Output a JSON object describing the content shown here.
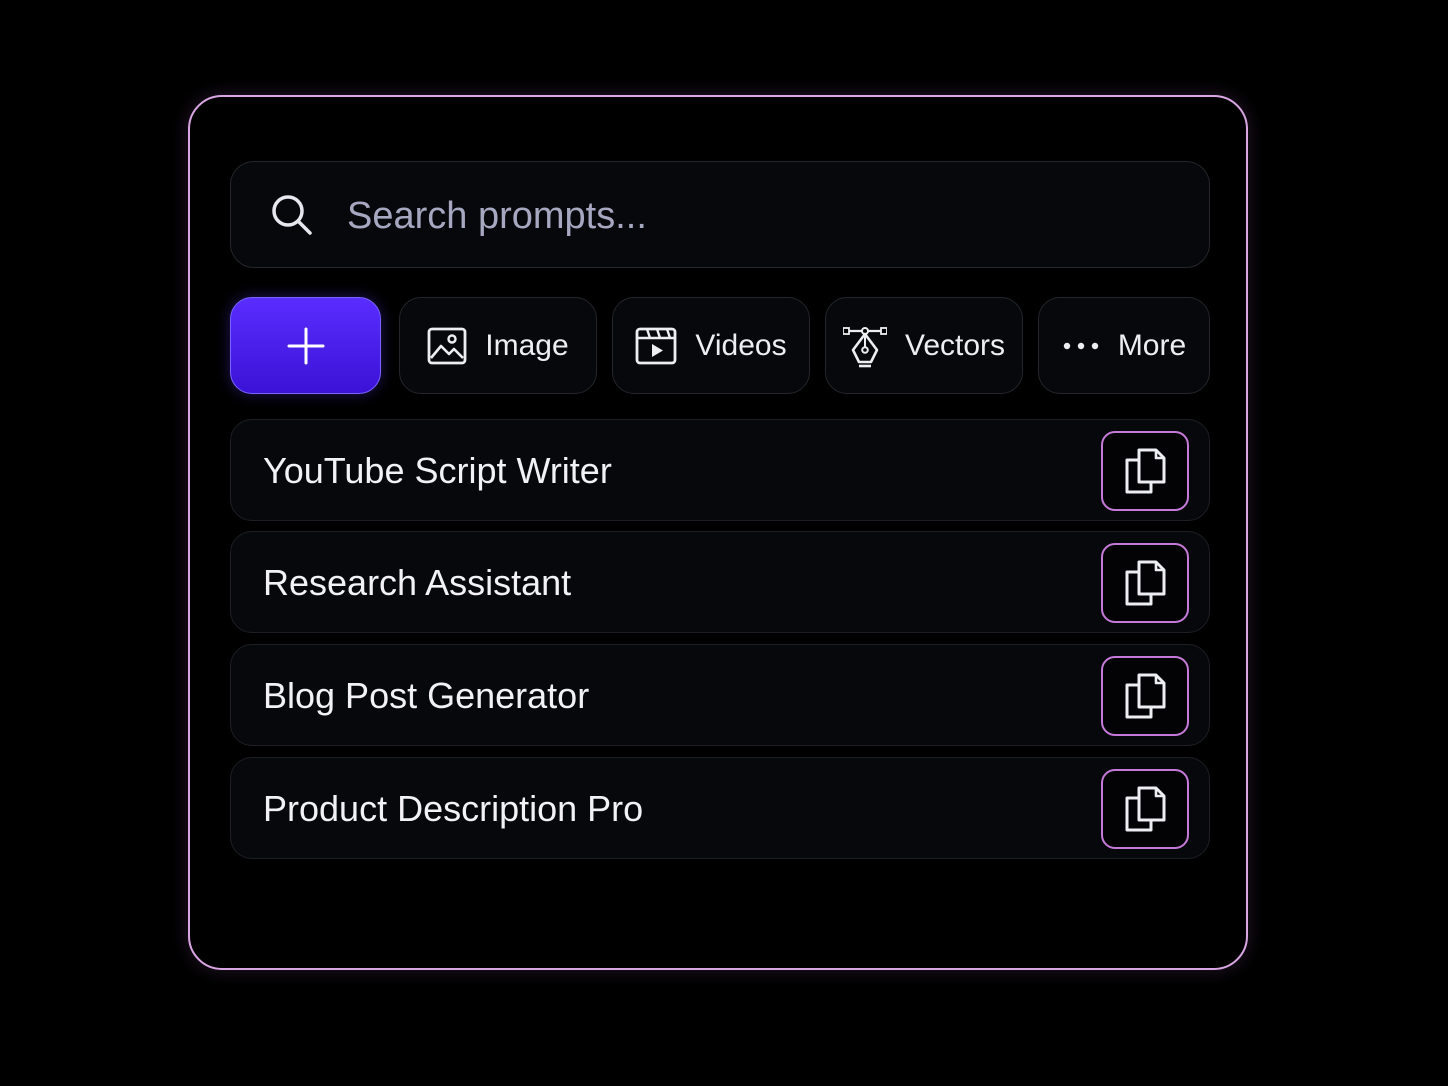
{
  "search": {
    "placeholder": "Search prompts...",
    "value": ""
  },
  "chips": {
    "add_icon": "plus-icon",
    "image": {
      "label": "Image",
      "icon": "image-icon"
    },
    "videos": {
      "label": "Videos",
      "icon": "video-clapper-icon"
    },
    "vectors": {
      "label": "Vectors",
      "icon": "pen-tool-icon"
    },
    "more": {
      "label": "More",
      "icon": "more-dots-icon"
    }
  },
  "prompts": [
    {
      "title": "YouTube Script Writer",
      "action_icon": "copy-icon"
    },
    {
      "title": "Research Assistant",
      "action_icon": "copy-icon"
    },
    {
      "title": "Blog Post Generator",
      "action_icon": "copy-icon"
    },
    {
      "title": "Product Description Pro",
      "action_icon": "copy-icon"
    }
  ],
  "colors": {
    "background": "#000000",
    "panel_border": "#d9a6e3",
    "accent_start": "#5a2dff",
    "accent_end": "#3b12d6",
    "copy_border": "#c579d9",
    "placeholder": "#a6a7c0"
  }
}
